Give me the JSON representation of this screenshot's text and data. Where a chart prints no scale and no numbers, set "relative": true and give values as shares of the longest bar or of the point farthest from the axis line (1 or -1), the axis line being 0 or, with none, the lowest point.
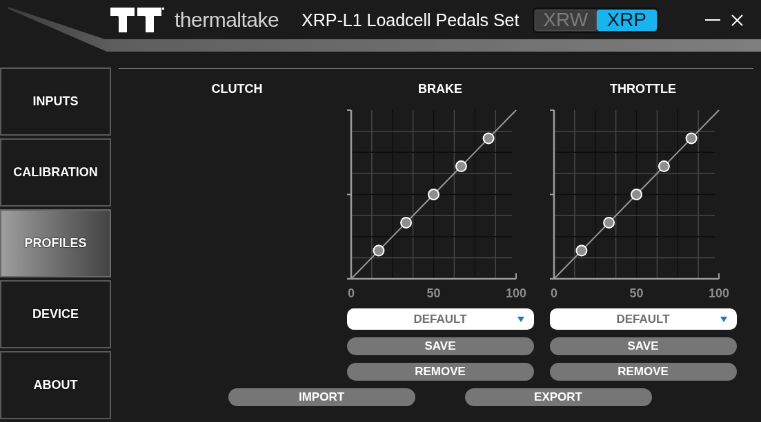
{
  "title_bar": {
    "logo_text": "thermaltake",
    "title": "XRP-L1 Loadcell Pedals Set",
    "model_switch": [
      {
        "label": "XRW",
        "selected": false
      },
      {
        "label": "XRP",
        "selected": true
      }
    ]
  },
  "sidebar": {
    "items": [
      {
        "label": "INPUTS",
        "selected": false
      },
      {
        "label": "CALIBRATION",
        "selected": false
      },
      {
        "label": "PROFILES",
        "selected": true
      },
      {
        "label": "DEVICE",
        "selected": false
      },
      {
        "label": "ABOUT",
        "selected": false
      }
    ]
  },
  "pedals": [
    {
      "title": "CLUTCH"
    },
    {
      "title": "BRAKE",
      "chart_data": {
        "type": "line",
        "relative": true,
        "x": [
          0,
          16.7,
          33.3,
          50,
          66.7,
          83.3,
          100
        ],
        "series": [
          {
            "color": "#9a9a9a",
            "values": [
              0,
              0.167,
              0.333,
              0.5,
              0.667,
              0.833,
              1
            ]
          }
        ],
        "xlim": [
          0,
          100
        ],
        "xticks": [
          0,
          50,
          100
        ]
      },
      "profile_select": {
        "value": "DEFAULT"
      },
      "buttons": [
        "SAVE",
        "REMOVE"
      ]
    },
    {
      "title": "THROTTLE",
      "chart_data": {
        "type": "line",
        "relative": true,
        "x": [
          0,
          16.7,
          33.3,
          50,
          66.7,
          83.3,
          100
        ],
        "series": [
          {
            "color": "#9a9a9a",
            "values": [
              0,
              0.167,
              0.333,
              0.5,
              0.667,
              0.833,
              1
            ]
          }
        ],
        "xlim": [
          0,
          100
        ],
        "xticks": [
          0,
          50,
          100
        ]
      },
      "profile_select": {
        "value": "DEFAULT"
      },
      "buttons": [
        "SAVE",
        "REMOVE"
      ]
    }
  ],
  "footer_buttons": [
    "IMPORT",
    "EXPORT"
  ]
}
